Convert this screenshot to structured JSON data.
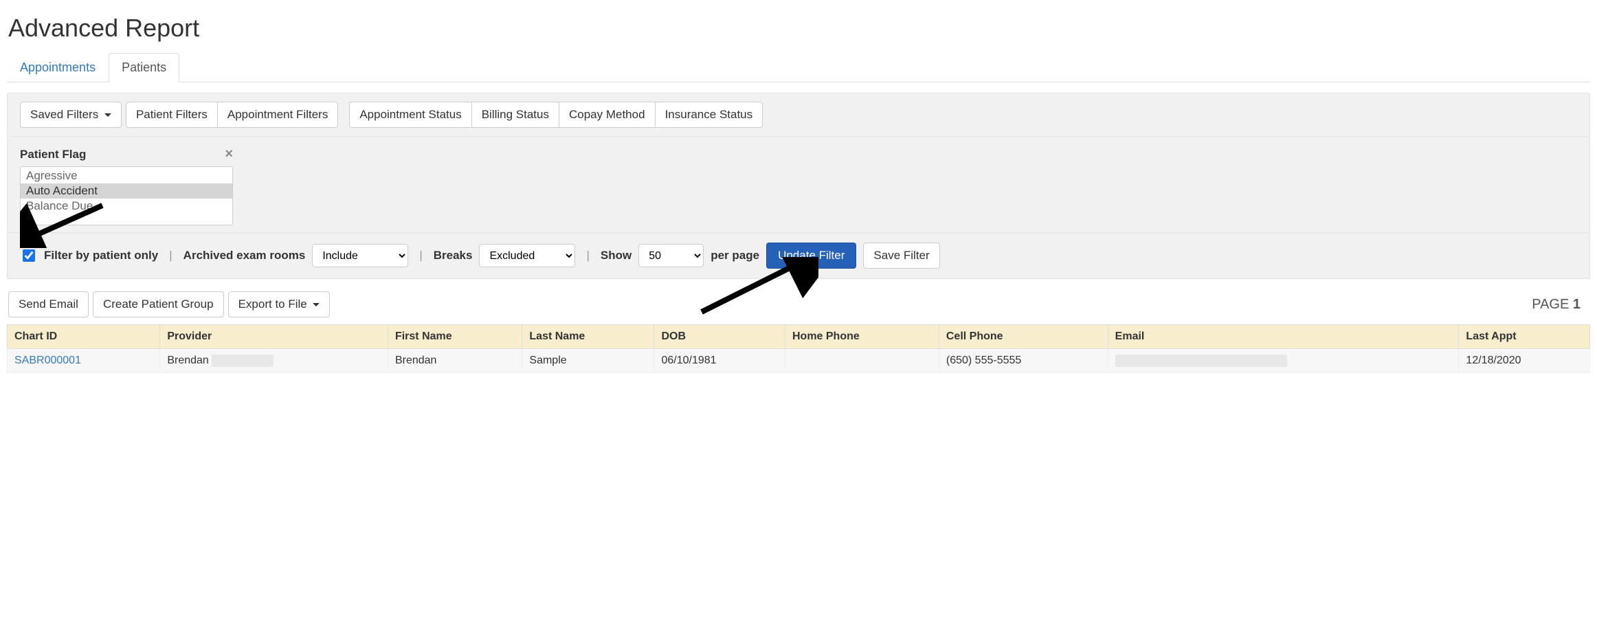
{
  "page": {
    "title": "Advanced Report"
  },
  "tabs": [
    {
      "label": "Appointments",
      "active": false
    },
    {
      "label": "Patients",
      "active": true
    }
  ],
  "toolbar": {
    "saved_filters": "Saved Filters",
    "group_filter_buttons": [
      "Patient Filters",
      "Appointment Filters"
    ],
    "group_status_buttons": [
      "Appointment Status",
      "Billing Status",
      "Copay Method",
      "Insurance Status"
    ]
  },
  "patient_flag": {
    "label": "Patient Flag",
    "close_icon": "×",
    "options": [
      "Agressive",
      "Auto Accident",
      "Balance Due"
    ],
    "selected_index": 1
  },
  "filter_bar": {
    "filter_by_patient_only": {
      "label": "Filter by patient only",
      "checked": true
    },
    "archived_label": "Archived exam rooms",
    "archived_options": [
      "Include"
    ],
    "archived_value": "Include",
    "breaks_label": "Breaks",
    "breaks_options": [
      "Excluded"
    ],
    "breaks_value": "Excluded",
    "show_label": "Show",
    "show_options": [
      "50"
    ],
    "show_value": "50",
    "per_page_label": "per page",
    "update_label": "Update Filter",
    "save_label": "Save Filter"
  },
  "actions": {
    "send_email": "Send Email",
    "create_group": "Create Patient Group",
    "export": "Export to File",
    "page_label": "PAGE",
    "page_number": "1"
  },
  "table": {
    "columns": [
      "Chart ID",
      "Provider",
      "First Name",
      "Last Name",
      "DOB",
      "Home Phone",
      "Cell Phone",
      "Email",
      "Last Appt"
    ],
    "rows": [
      {
        "chart_id": "SABR000001",
        "provider": "Brendan",
        "provider_redacted": true,
        "first_name": "Brendan",
        "last_name": "Sample",
        "dob": "06/10/1981",
        "home_phone": "",
        "cell_phone": "(650) 555-5555",
        "email": "",
        "email_redacted": true,
        "last_appt": "12/18/2020"
      }
    ]
  }
}
